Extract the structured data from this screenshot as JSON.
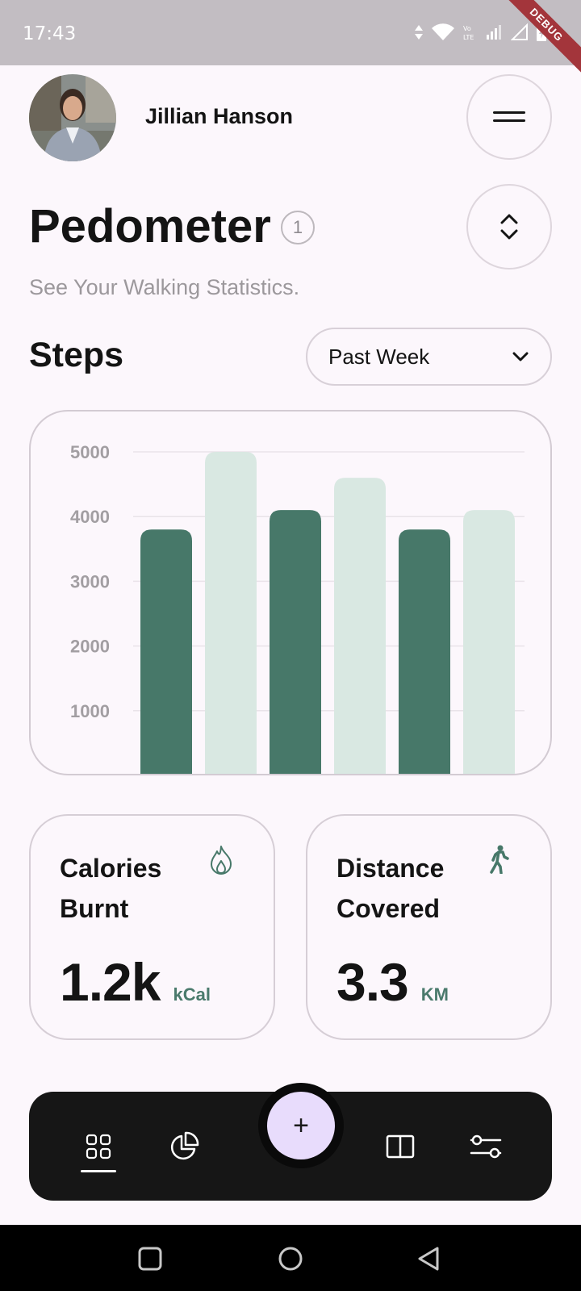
{
  "status_bar": {
    "time": "17:43",
    "debug_label": "DEBUG",
    "icons": [
      "data-arrows-icon",
      "wifi-icon",
      "volte-icon",
      "signal-icon",
      "signal-empty-icon",
      "battery-icon"
    ]
  },
  "header": {
    "user_name": "Jillian Hanson",
    "menu_icon": "menu-icon",
    "sort_icon": "sort-icon"
  },
  "page": {
    "title": "Pedometer",
    "badge": "1",
    "subtitle": "See Your Walking Statistics."
  },
  "steps": {
    "title": "Steps",
    "period": "Past Week"
  },
  "chart_data": {
    "type": "bar",
    "categories": [
      "",
      "",
      "",
      "",
      "",
      ""
    ],
    "values": [
      3800,
      5000,
      4100,
      4600,
      3800,
      4100
    ],
    "y_ticks": [
      "1000",
      "2000",
      "3000",
      "4000",
      "5000"
    ],
    "ylim": [
      0,
      5000
    ],
    "grid": true,
    "colors": [
      "#477869",
      "#d9e8e2"
    ]
  },
  "stats": {
    "calories": {
      "label_line1": "Calories",
      "label_line2": "Burnt",
      "value": "1.2k",
      "unit": "kCal",
      "icon": "flame-icon"
    },
    "distance": {
      "label_line1": "Distance",
      "label_line2": "Covered",
      "value": "3.3",
      "unit": "KM",
      "icon": "walking-icon"
    }
  },
  "bottom_nav": {
    "items": [
      "dashboard-icon",
      "pie-chart-icon",
      "add-icon",
      "book-icon",
      "settings-sliders-icon"
    ],
    "fab_symbol": "+",
    "active": "dashboard-icon"
  },
  "colors": {
    "accent": "#477869",
    "accent_light": "#d9e8e2",
    "background": "#fcf7fc",
    "nav_bg": "#161616",
    "fab": "#e8dcfc"
  }
}
